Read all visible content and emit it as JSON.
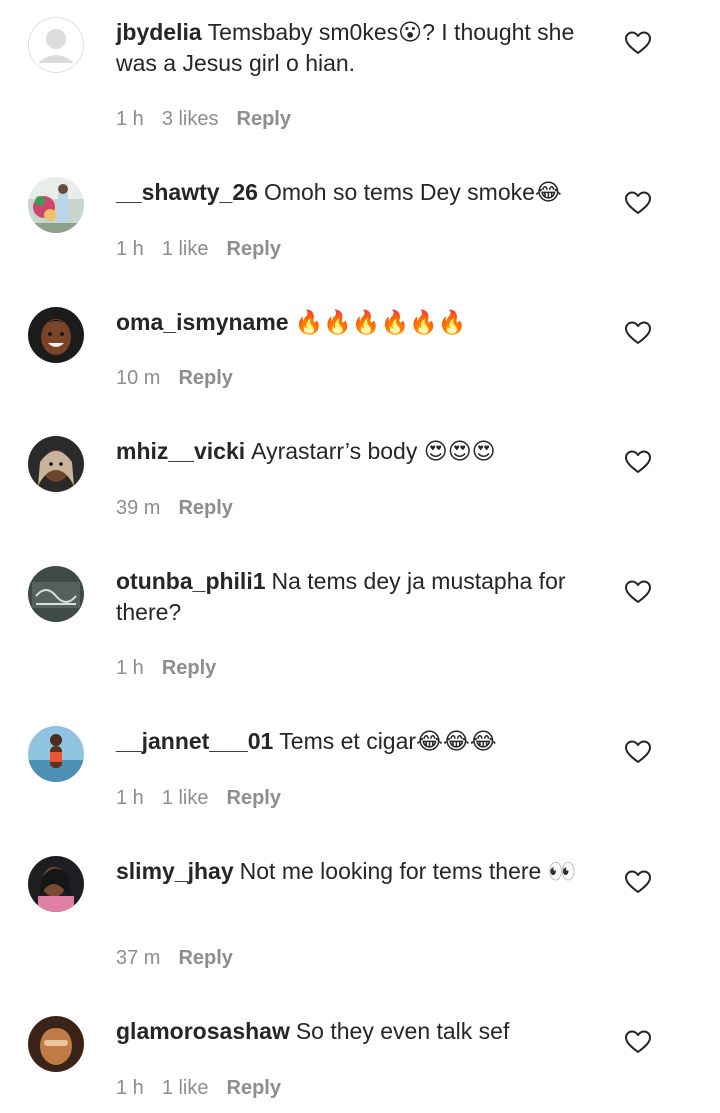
{
  "comments": [
    {
      "username": "jbydelia",
      "text": "Temsbaby sm0kes😮? I thought she was a Jesus girl o hian.",
      "time": "1 h",
      "likes": "3 likes",
      "reply": "Reply",
      "avatar": "default-avatar"
    },
    {
      "username": "__shawty_26",
      "text": "Omoh so tems Dey smoke😂",
      "time": "1 h",
      "likes": "1 like",
      "reply": "Reply",
      "avatar": "photo-avatar"
    },
    {
      "username": "oma_ismyname",
      "text": "🔥🔥🔥🔥🔥🔥",
      "time": "10 m",
      "likes": "",
      "reply": "Reply",
      "avatar": "photo-avatar"
    },
    {
      "username": "mhiz__vicki",
      "text": "Ayrastarr’s body 😍😍😍",
      "time": "39 m",
      "likes": "",
      "reply": "Reply",
      "avatar": "photo-avatar"
    },
    {
      "username": "otunba_phili1",
      "text": "Na tems dey ja mustapha for there?",
      "time": "1 h",
      "likes": "",
      "reply": "Reply",
      "avatar": "photo-avatar"
    },
    {
      "username": "__jannet___01",
      "text": "Tems et cigar😂😂😂",
      "time": "1 h",
      "likes": "1 like",
      "reply": "Reply",
      "avatar": "photo-avatar"
    },
    {
      "username": "slimy_jhay",
      "text": "Not me looking for tems there 👀",
      "time": "37 m",
      "likes": "",
      "reply": "Reply",
      "avatar": "photo-avatar"
    },
    {
      "username": "glamorosashaw",
      "text": "So they even talk sef",
      "time": "1 h",
      "likes": "1 like",
      "reply": "Reply",
      "avatar": "photo-avatar"
    }
  ],
  "colors": {
    "text": "#262626",
    "secondary": "#8e8e8e",
    "avatar_placeholder": "#dbdbdb"
  },
  "icons": {
    "like": "heart-outline-icon"
  }
}
